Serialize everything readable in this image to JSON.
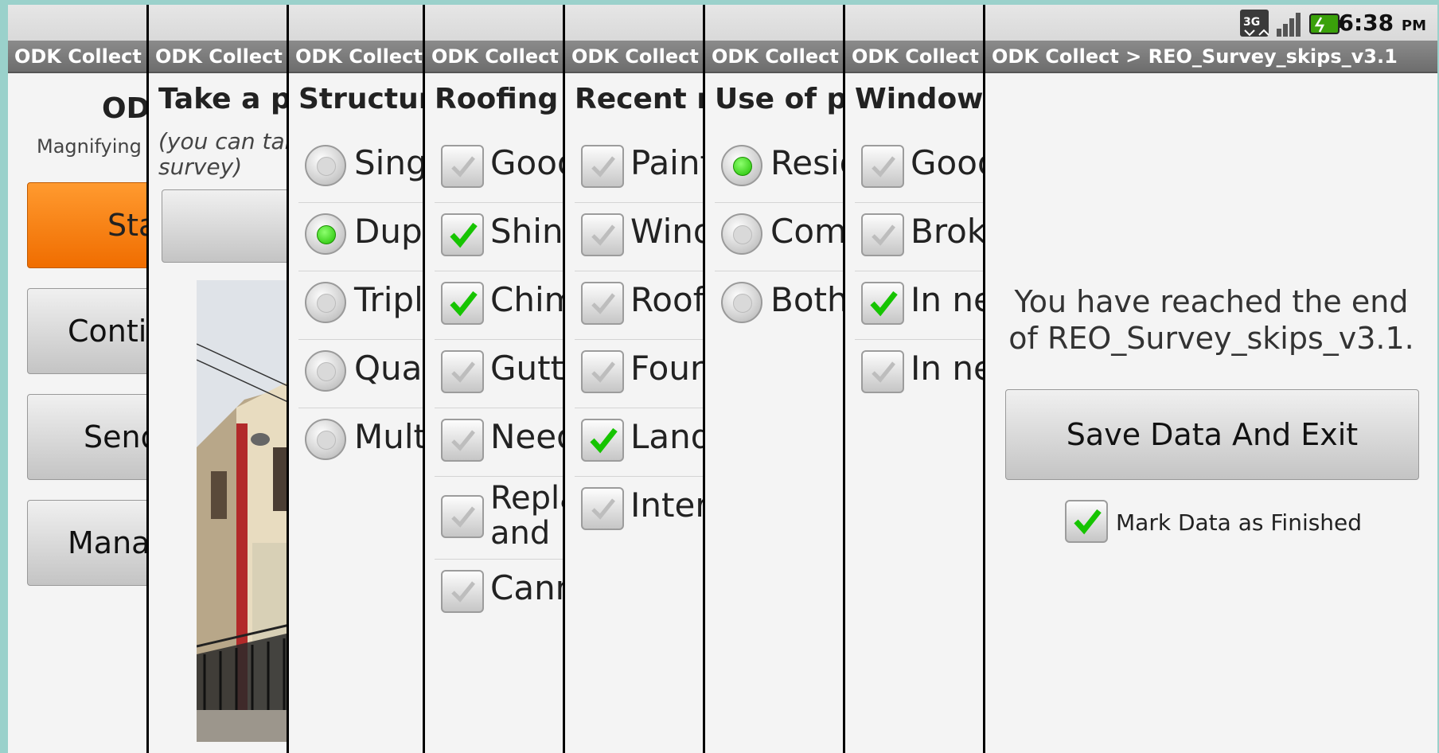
{
  "statusbar": {
    "time": "6:38",
    "ampm": "PM",
    "network": "3G"
  },
  "breadcrumb": "ODK Collect >",
  "final_title": "ODK Collect > REO_Survey_skips_v3.1",
  "panels": {
    "main_menu": {
      "title": "OD",
      "subtitle": "Magnifying h",
      "buttons": [
        "Sta",
        "Conti",
        "Send",
        "Mana"
      ]
    },
    "photo": {
      "title": "Take a pi",
      "hint": "(you can take",
      "hint2": "survey)"
    },
    "structure": {
      "title": "Structure",
      "options": [
        {
          "label": "Singl",
          "selected": false
        },
        {
          "label": "Dupl",
          "selected": true
        },
        {
          "label": "Triple",
          "selected": false
        },
        {
          "label": "Quad",
          "selected": false
        },
        {
          "label": "Multi",
          "selected": false
        }
      ]
    },
    "roofing": {
      "title": "Roofing",
      "options": [
        {
          "label": "Good",
          "checked": false
        },
        {
          "label": "Shing",
          "checked": true
        },
        {
          "label": "Chim",
          "checked": true
        },
        {
          "label": "Gutte",
          "checked": false
        },
        {
          "label": "Need",
          "checked": false
        },
        {
          "label": "Repla",
          "label2": "and r",
          "checked": false
        },
        {
          "label": "Cann",
          "checked": false
        }
      ]
    },
    "recent": {
      "title": "Recent re",
      "options": [
        {
          "label": "Paint",
          "checked": false
        },
        {
          "label": "Wind",
          "checked": false
        },
        {
          "label": "Roof",
          "checked": false
        },
        {
          "label": "Found",
          "checked": false
        },
        {
          "label": "Lands",
          "checked": true
        },
        {
          "label": "Interi",
          "checked": false
        }
      ]
    },
    "use": {
      "title": "Use of pr",
      "options": [
        {
          "label": "Resid",
          "selected": true
        },
        {
          "label": "Comm",
          "selected": false
        },
        {
          "label": "Both",
          "selected": false
        }
      ]
    },
    "windows": {
      "title": "Windows",
      "options": [
        {
          "label": "Good",
          "checked": false
        },
        {
          "label": "Broke",
          "checked": false
        },
        {
          "label": "In ne",
          "checked": true
        },
        {
          "label": "In ne",
          "checked": false
        }
      ]
    },
    "end": {
      "message_line1": "You have reached the end",
      "message_line2": "of REO_Survey_skips_v3.1.",
      "save_label": "Save Data And Exit",
      "finished_label": "Mark Data as Finished",
      "finished_checked": true
    }
  }
}
